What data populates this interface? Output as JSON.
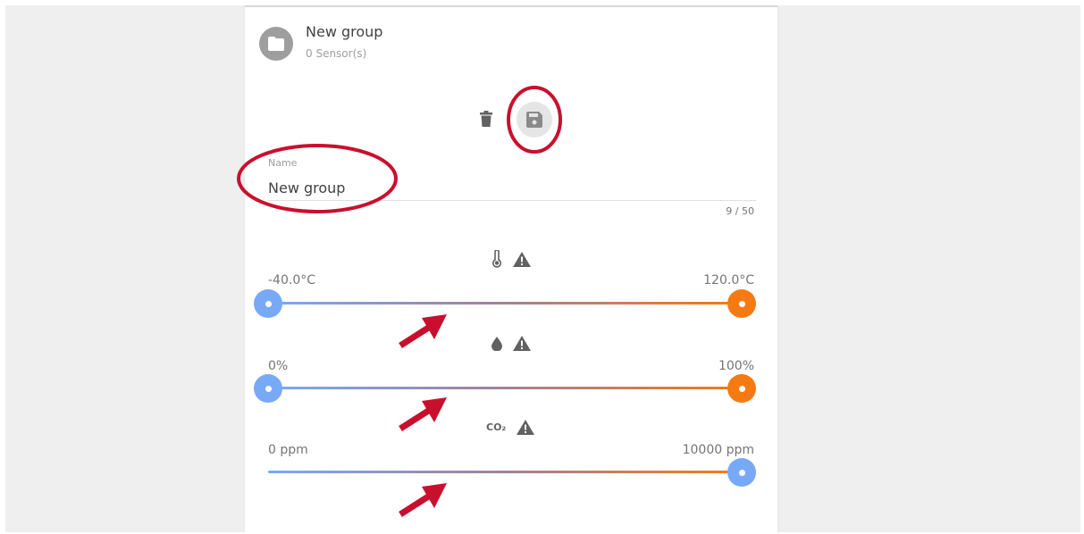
{
  "group": {
    "title": "New group",
    "sensor_count": "0 Sensor(s)"
  },
  "actions": {
    "delete_icon": "trash-icon",
    "save_icon": "floppy-disk-icon"
  },
  "name_field": {
    "label": "Name",
    "value": "New group",
    "counter": "9 / 50"
  },
  "sliders": [
    {
      "sensor_icon": "thermometer-icon",
      "min_label": "-40.0°C",
      "max_label": "120.0°C",
      "range": [
        0,
        1
      ]
    },
    {
      "sensor_icon": "water-drop-icon",
      "min_label": "0%",
      "max_label": "100%",
      "range": [
        0,
        1
      ]
    },
    {
      "sensor_icon": "co2-icon",
      "co2_text": "CO₂",
      "min_label": "0 ppm",
      "max_label": "10000 ppm",
      "range": [
        1,
        1
      ]
    }
  ],
  "colors": {
    "low": "#78a9f7",
    "high": "#f67a12",
    "annotation": "#c8102e"
  }
}
